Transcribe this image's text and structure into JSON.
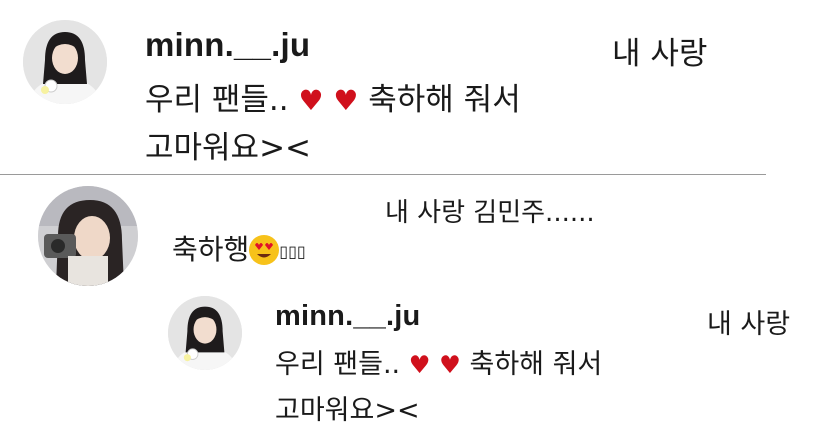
{
  "comment1": {
    "username": "minn.__.ju",
    "right_text": "내 사랑",
    "line1_a": "우리 팬들..",
    "line1_b": "축하해 줘서",
    "line2": "고마워요><"
  },
  "comment2": {
    "top_text": "내 사랑 김민주......",
    "text": "축하행",
    "boxes": "▯▯▯"
  },
  "reply": {
    "username": "minn.__.ju",
    "right_text": "내 사랑",
    "line1_a": "우리 팬들..",
    "line1_b": "축하해 줘서",
    "line2": "고마워요><"
  },
  "icons": {
    "heart": "heart-icon",
    "emoji": "heart-eyes-emoji-icon"
  },
  "colors": {
    "heart": "#d0101c",
    "divider": "#9a9a9a"
  }
}
